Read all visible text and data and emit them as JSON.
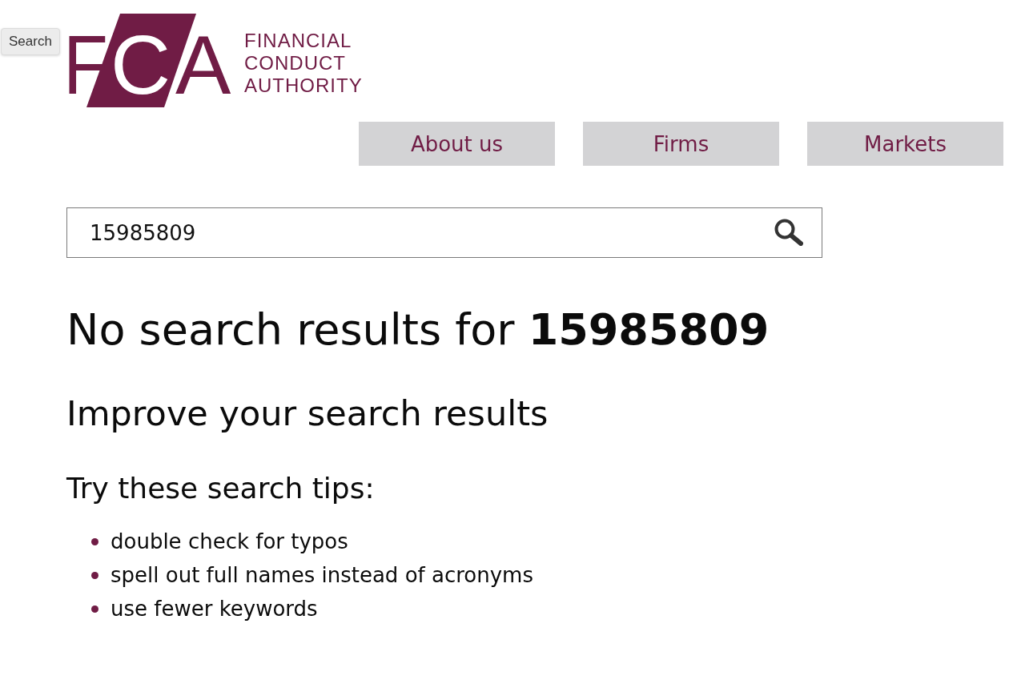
{
  "tooltip": {
    "text": "Search"
  },
  "logo": {
    "mark": "FCA",
    "name_lines": [
      "FINANCIAL",
      "CONDUCT",
      "AUTHORITY"
    ]
  },
  "nav": [
    {
      "label": "About us"
    },
    {
      "label": "Firms"
    },
    {
      "label": "Markets"
    }
  ],
  "search": {
    "value": "15985809"
  },
  "results_heading": "No search results for **15985809**",
  "subheading": "Improve your search results",
  "tips": {
    "title": "Try these search tips:",
    "items": [
      "double check for typos",
      "spell out full names instead of acronyms",
      "use fewer keywords"
    ]
  }
}
